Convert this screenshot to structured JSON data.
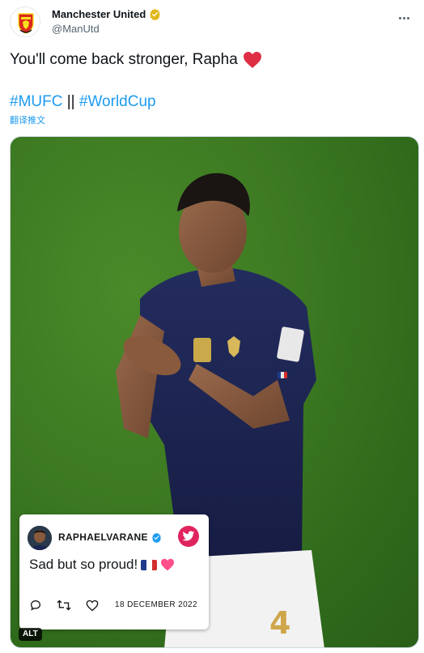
{
  "tweet": {
    "author": {
      "display_name": "Manchester United",
      "handle": "@ManUtd",
      "verified": true,
      "avatar_icon": "manchester-united-crest-icon"
    },
    "text": "You'll come back stronger, Rapha",
    "text_emoji": "red-heart-icon",
    "hashtags": {
      "first": "#MUFC",
      "separator": " || ",
      "second": "#WorldCup"
    },
    "translate_label": "翻译推文",
    "more_icon": "more-options-icon"
  },
  "media": {
    "alt_badge": "ALT",
    "embedded_tweet": {
      "username": "RAPHAELVARANE",
      "verified": true,
      "text": "Sad but so proud!",
      "flag_icon": "france-flag-icon",
      "heart_icon": "pink-heart-icon",
      "date": "18 DECEMBER 2022",
      "actions": [
        "reply-icon",
        "retweet-icon",
        "like-icon"
      ],
      "brand_icon": "twitter-bird-icon"
    },
    "jersey_number": "4"
  },
  "colors": {
    "link": "#1d9bf0",
    "text": "#0f1419",
    "muted": "#536471",
    "verified_gold": "#e2b719",
    "verified_blue": "#1d9bf0",
    "pitch_green": "#3d7a22",
    "jersey_navy": "#1b2452",
    "twitter_red": "#e0245e"
  }
}
